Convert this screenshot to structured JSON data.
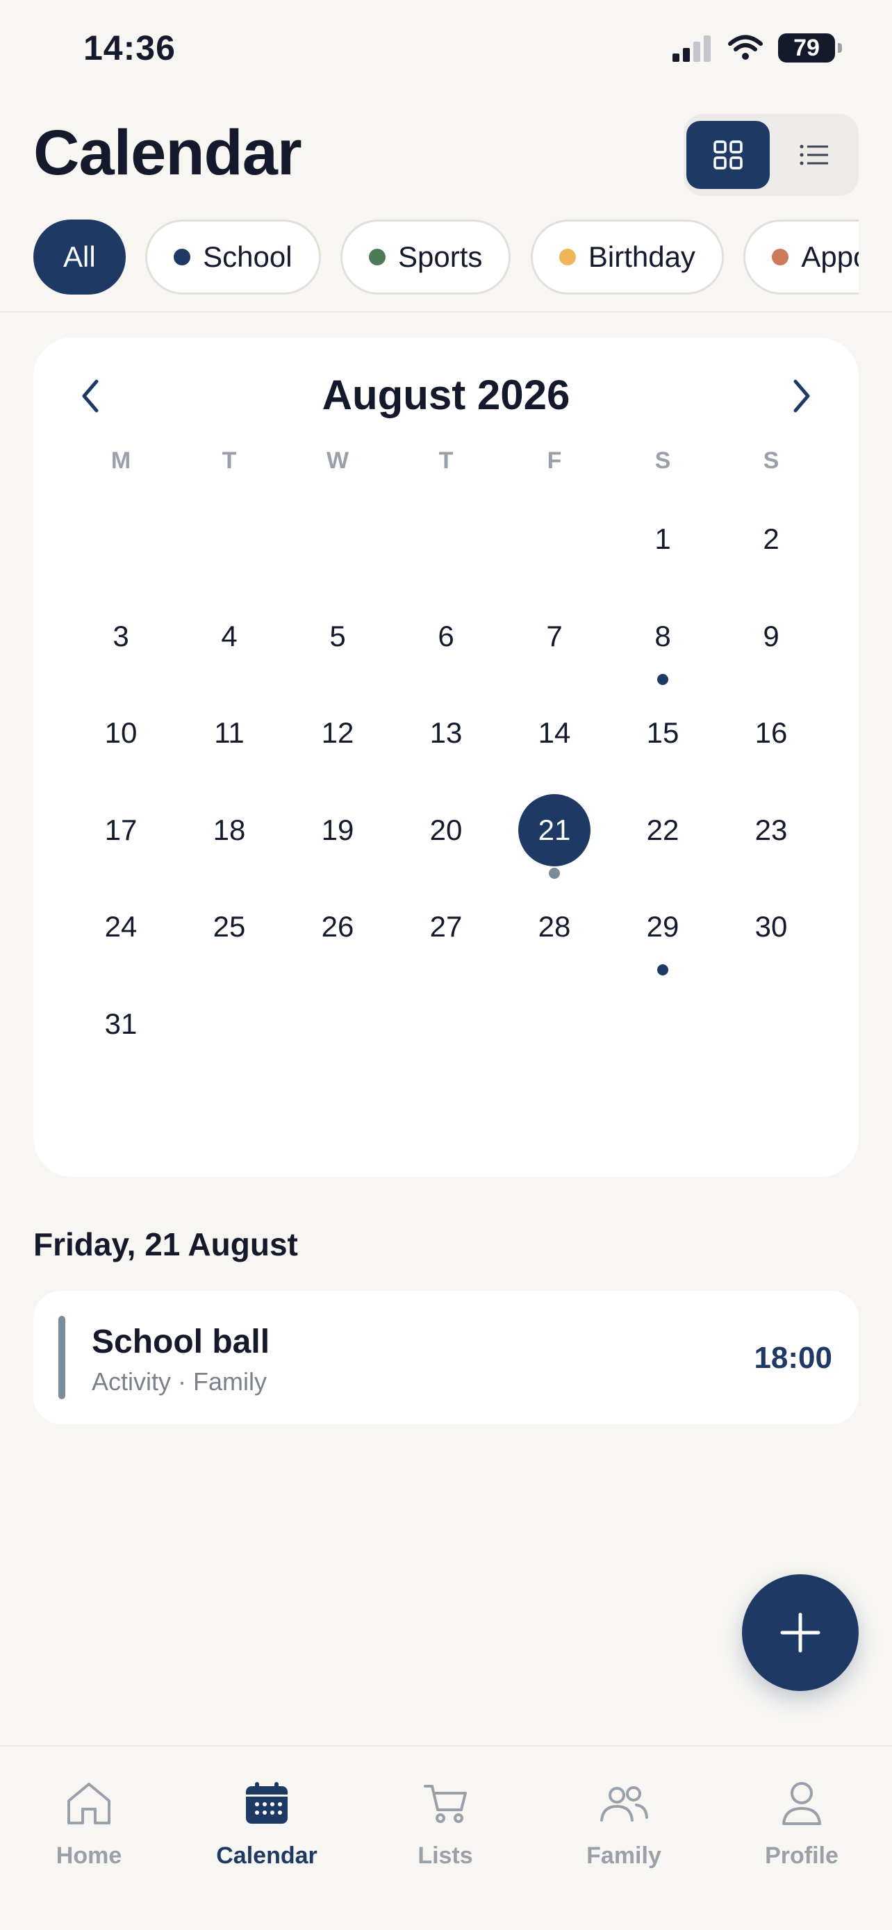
{
  "status_bar": {
    "time": "14:36",
    "battery": "79"
  },
  "header": {
    "title": "Calendar"
  },
  "filters": [
    {
      "label": "All",
      "active": true
    },
    {
      "label": "School",
      "color": "#1e3a64"
    },
    {
      "label": "Sports",
      "color": "#4f7a58"
    },
    {
      "label": "Birthday",
      "color": "#efb659"
    },
    {
      "label": "Appointment",
      "color": "#cd7a5a"
    }
  ],
  "calendar": {
    "month_label": "August 2026",
    "weekdays": [
      "M",
      "T",
      "W",
      "T",
      "F",
      "S",
      "S"
    ],
    "selected_day": "21",
    "days_with_events": [
      "8",
      "21",
      "29"
    ],
    "weeks": [
      [
        "",
        "",
        "",
        "",
        "",
        "1",
        "2"
      ],
      [
        "3",
        "4",
        "5",
        "6",
        "7",
        "8",
        "9"
      ],
      [
        "10",
        "11",
        "12",
        "13",
        "14",
        "15",
        "16"
      ],
      [
        "17",
        "18",
        "19",
        "20",
        "21",
        "22",
        "23"
      ],
      [
        "24",
        "25",
        "26",
        "27",
        "28",
        "29",
        "30"
      ],
      [
        "31",
        "",
        "",
        "",
        "",
        "",
        ""
      ]
    ]
  },
  "selected_date": {
    "heading": "Friday, 21 August",
    "events": [
      {
        "title": "School ball",
        "subtitle": "Activity · Family",
        "time": "18:00",
        "color": "#7a8b99"
      }
    ]
  },
  "tabs": [
    {
      "label": "Home",
      "icon": "home-icon"
    },
    {
      "label": "Calendar",
      "icon": "calendar-icon",
      "active": true
    },
    {
      "label": "Lists",
      "icon": "cart-icon"
    },
    {
      "label": "Family",
      "icon": "family-icon"
    },
    {
      "label": "Profile",
      "icon": "profile-icon"
    }
  ]
}
